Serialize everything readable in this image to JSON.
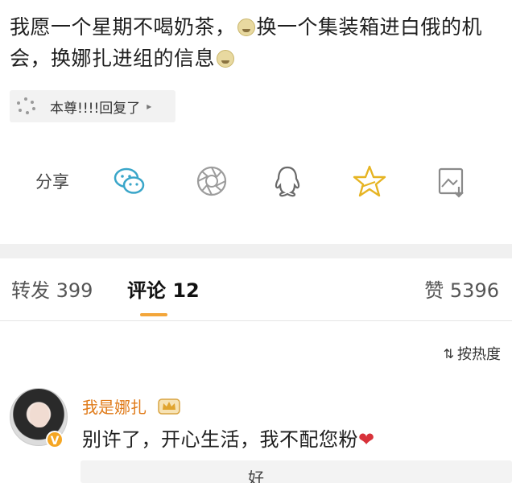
{
  "post": {
    "text_part1": "我愿一个星期不喝奶茶，",
    "text_part2": "换一个集装箱进白俄的机会，换娜扎进组的信息"
  },
  "repost": {
    "label": "本尊!!!!回复了",
    "arrow": "▸"
  },
  "share": {
    "label": "分享",
    "icons": [
      "wechat-icon",
      "moments-icon",
      "qq-icon",
      "favorite-star-icon",
      "save-image-icon"
    ]
  },
  "tabs": {
    "reposts": "转发 399",
    "comments": "评论 12",
    "likes": "赞 5396",
    "active_color": "#f3a63a"
  },
  "sort": {
    "label": "按热度",
    "icon": "sort-icon"
  },
  "comment": {
    "author": "我是娜扎",
    "text": "别许了，开心生活，我不配您粉",
    "badge": "V",
    "author_color": "#e07b1a"
  },
  "reply_preview": {
    "text": "好"
  }
}
